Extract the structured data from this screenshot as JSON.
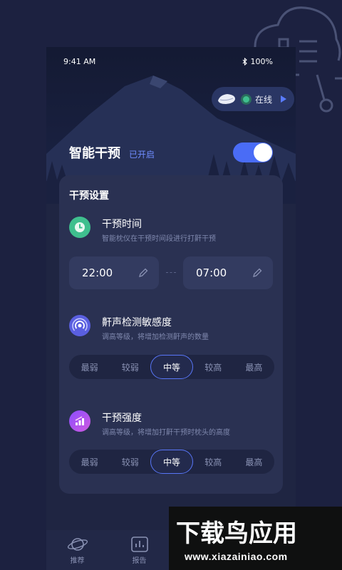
{
  "status_bar": {
    "time": "9:41 AM",
    "battery": "100%"
  },
  "device": {
    "status_label": "在线"
  },
  "smart_intervention": {
    "title": "智能干预",
    "status": "已开启",
    "enabled": true
  },
  "settings": {
    "title": "干预设置",
    "time_section": {
      "title": "干预时间",
      "description": "智能枕仪在干预时间段进行打鼾干预",
      "start_time": "22:00",
      "end_time": "07:00"
    },
    "sensitivity_section": {
      "title": "鼾声检测敏感度",
      "description": "调高等级，将增加检测鼾声的数量",
      "options": [
        "最弱",
        "较弱",
        "中等",
        "较高",
        "最高"
      ],
      "selected": "中等"
    },
    "strength_section": {
      "title": "干预强度",
      "description": "调高等级，将增加打鼾干预时枕头的高度",
      "options": [
        "最弱",
        "较弱",
        "中等",
        "较高",
        "最高"
      ],
      "selected": "中等"
    }
  },
  "tabbar": {
    "tabs": [
      {
        "label": "推荐",
        "icon": "planet-icon"
      },
      {
        "label": "报告",
        "icon": "chart-icon"
      }
    ]
  },
  "watermark": {
    "main": "下载鸟应用",
    "url": "www.xiazainiao.com"
  },
  "colors": {
    "accent": "#4a6cf6",
    "online": "#3fbf8e",
    "card": "#2a3152",
    "background": "#1c2140"
  }
}
